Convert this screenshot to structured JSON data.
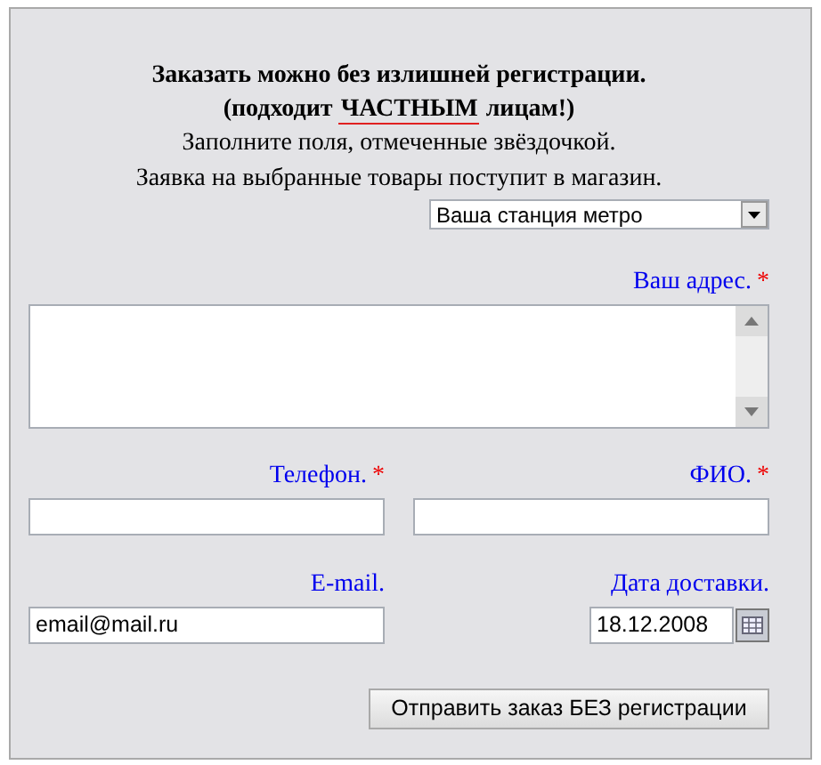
{
  "heading": {
    "line_1": "Заказать можно без излишней регистрации.",
    "line_2": {
      "before": "(подходит",
      "emphasis": "ЧАСТНЫМ",
      "after": "лицам!)"
    }
  },
  "notes": [
    "Заполните поля, отмеченные звёздочкой.",
    "Заявка на выбранные товары поступит в магазин."
  ],
  "metro_select": {
    "value": "Ваша станция метро"
  },
  "fields": [
    {
      "kind": "textarea",
      "label": "Ваш адрес.",
      "required_mark": "*"
    },
    {
      "kind": "text",
      "label": "Телефон.",
      "required_mark": "*"
    },
    {
      "kind": "text",
      "label": "ФИО.",
      "required_mark": "*"
    },
    {
      "kind": "text",
      "label": "E-mail.",
      "value": "email@mail.ru"
    },
    {
      "kind": "date",
      "label": "Дата доставки.",
      "value": "18.12.2008"
    }
  ],
  "submit_button": "Отправить заказ БЕЗ регистрации"
}
